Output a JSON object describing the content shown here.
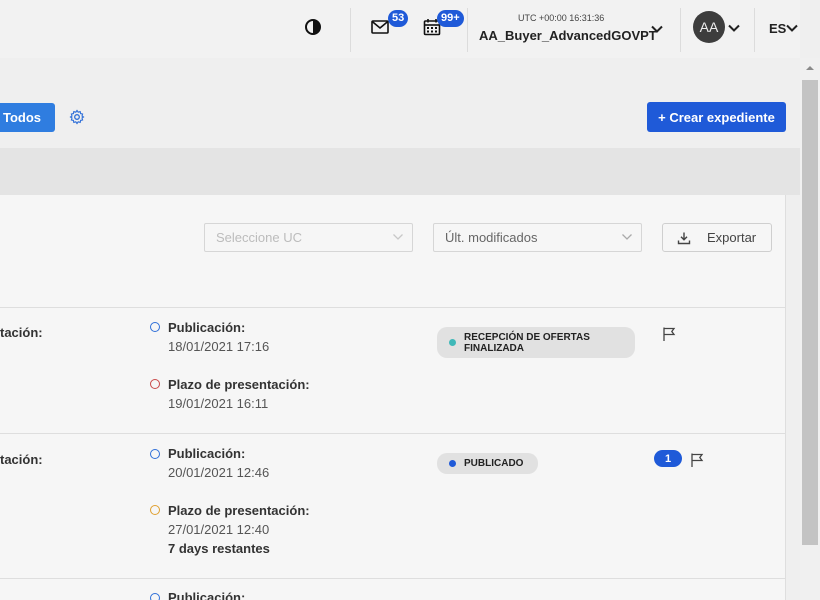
{
  "header": {
    "mail_count": "53",
    "calendar_count": "99+",
    "utc_time": "UTC +00:00 16:31:36",
    "account_name": "AA_Buyer_AdvancedGOVPT",
    "avatar_initials": "AA",
    "language": "ES"
  },
  "toolbar": {
    "todos_label": "Todos",
    "crear_label": "+ Crear expediente"
  },
  "filters": {
    "uc_placeholder": "Seleccione UC",
    "sort_value": "Últ. modificados",
    "export_label": "Exportar"
  },
  "rows": [
    {
      "left_label": "tación:",
      "pub_label": "Publicación:",
      "pub_date": "18/01/2021 17:16",
      "plazo_label": "Plazo de presentación:",
      "plazo_date": "19/01/2021 16:11",
      "status_line1": "RECEPCIÓN DE OFERTAS",
      "status_line2": "FINALIZADA",
      "status_color": "#3fb8b8",
      "plazo_dot_color": "#c94a4a"
    },
    {
      "left_label": "tación:",
      "pub_label": "Publicación:",
      "pub_date": "20/01/2021 12:46",
      "plazo_label": "Plazo de presentación:",
      "plazo_date": "27/01/2021 12:40",
      "remaining": "7 days restantes",
      "status_line1": "PUBLICADO",
      "status_color": "#1f5ad8",
      "plazo_dot_color": "#e0a030",
      "count": "1"
    },
    {
      "pub_label": "Publicación:"
    }
  ],
  "colors": {
    "primary": "#1f5ad8",
    "todos": "#2f7de0"
  }
}
